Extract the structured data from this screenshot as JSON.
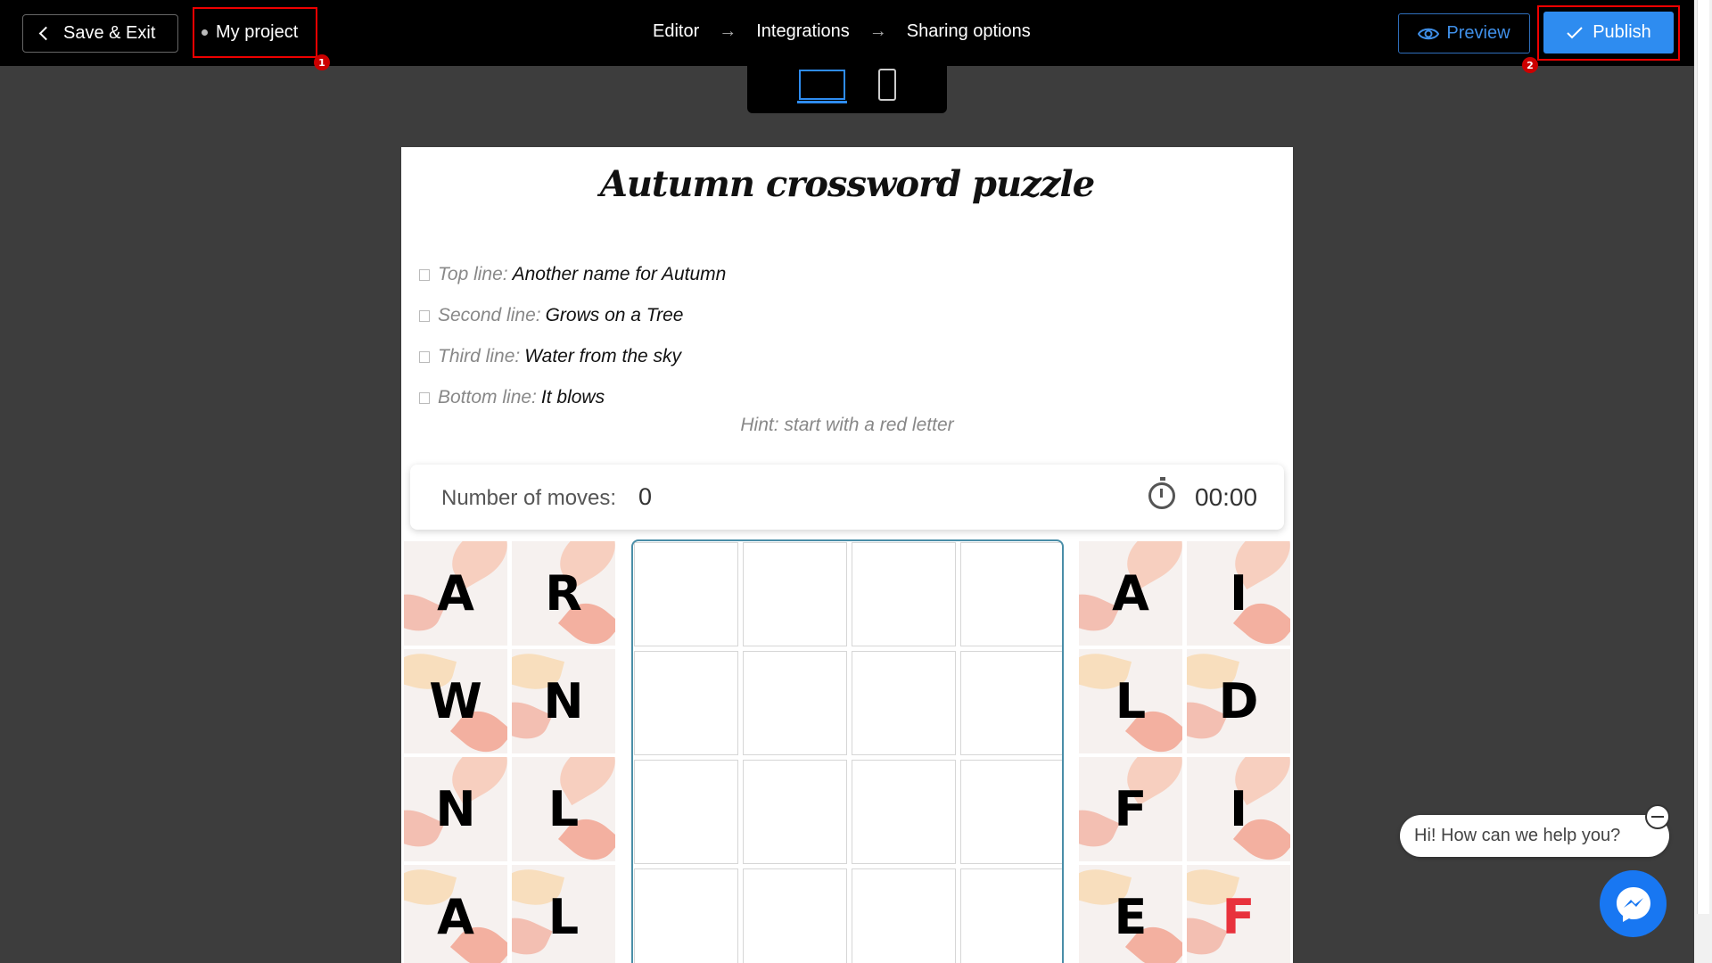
{
  "topbar": {
    "save_exit_label": "Save & Exit",
    "project_name": "My project",
    "badge_1": "1",
    "badge_2": "2",
    "steps": [
      "Editor",
      "Integrations",
      "Sharing options"
    ],
    "preview_label": "Preview",
    "publish_label": "Publish",
    "accent_color": "#2e8cf0",
    "highlight_color": "#e00000"
  },
  "device_toggle": {
    "options": [
      "desktop-icon",
      "mobile-icon"
    ],
    "selected": "desktop-icon"
  },
  "puzzle": {
    "title": "Autumn crossword puzzle",
    "clues": [
      {
        "label": "Top line:",
        "value": "Another name for Autumn"
      },
      {
        "label": "Second line:",
        "value": "Grows on a Tree"
      },
      {
        "label": "Third line:",
        "value": "Water from the sky"
      },
      {
        "label": "Bottom line:",
        "value": "It blows"
      }
    ],
    "hint": "Hint: start with a red letter",
    "moves_label": "Number of moves:",
    "moves_value": "0",
    "timer_value": "00:00",
    "left_tiles": [
      "A",
      "R",
      "W",
      "N",
      "N",
      "L",
      "A",
      "L"
    ],
    "right_tiles": [
      "A",
      "I",
      "L",
      "D",
      "F",
      "I",
      "E",
      "F"
    ],
    "red_letter_color": "#e8323c"
  },
  "chat": {
    "prompt": "Hi! How can we help you?"
  }
}
